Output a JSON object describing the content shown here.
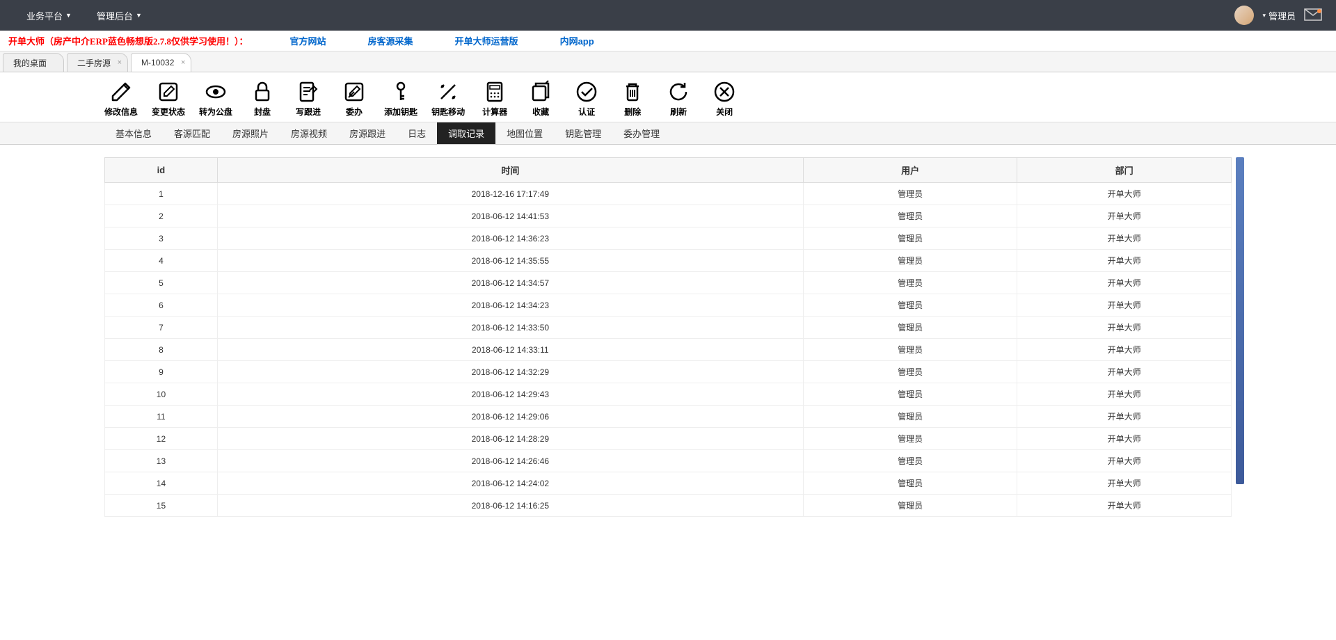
{
  "navbar": {
    "menus": [
      "业务平台",
      "管理后台"
    ],
    "user_label": "管理员"
  },
  "announce": {
    "title": "开单大师（房产中介ERP蓝色畅想版2.7.8仅供学习使用！）：",
    "links": [
      "官方网站",
      "房客源采集",
      "开单大师运营版",
      "内网app"
    ]
  },
  "doc_tabs": [
    {
      "label": "我的桌面",
      "closable": false
    },
    {
      "label": "二手房源",
      "closable": true
    },
    {
      "label": "M-10032",
      "closable": true,
      "active": true
    }
  ],
  "toolbar": [
    {
      "id": "edit-info",
      "label": "修改信息"
    },
    {
      "id": "change-status",
      "label": "变更状态"
    },
    {
      "id": "to-public",
      "label": "转为公盘"
    },
    {
      "id": "seal",
      "label": "封盘"
    },
    {
      "id": "write-followup",
      "label": "写跟进"
    },
    {
      "id": "delegate",
      "label": "委办"
    },
    {
      "id": "add-key",
      "label": "添加钥匙"
    },
    {
      "id": "key-move",
      "label": "钥匙移动"
    },
    {
      "id": "calculator",
      "label": "计算器"
    },
    {
      "id": "favorite",
      "label": "收藏"
    },
    {
      "id": "verify",
      "label": "认证"
    },
    {
      "id": "delete",
      "label": "删除"
    },
    {
      "id": "refresh",
      "label": "刷新"
    },
    {
      "id": "close",
      "label": "关闭"
    }
  ],
  "subtabs": [
    "基本信息",
    "客源匹配",
    "房源照片",
    "房源视频",
    "房源跟进",
    "日志",
    "调取记录",
    "地图位置",
    "钥匙管理",
    "委办管理"
  ],
  "subtab_active_index": 6,
  "table": {
    "headers": [
      "id",
      "时间",
      "用户",
      "部门"
    ],
    "rows": [
      {
        "id": "1",
        "time": "2018-12-16 17:17:49",
        "user": "管理员",
        "dept": "开单大师"
      },
      {
        "id": "2",
        "time": "2018-06-12 14:41:53",
        "user": "管理员",
        "dept": "开单大师"
      },
      {
        "id": "3",
        "time": "2018-06-12 14:36:23",
        "user": "管理员",
        "dept": "开单大师"
      },
      {
        "id": "4",
        "time": "2018-06-12 14:35:55",
        "user": "管理员",
        "dept": "开单大师"
      },
      {
        "id": "5",
        "time": "2018-06-12 14:34:57",
        "user": "管理员",
        "dept": "开单大师"
      },
      {
        "id": "6",
        "time": "2018-06-12 14:34:23",
        "user": "管理员",
        "dept": "开单大师"
      },
      {
        "id": "7",
        "time": "2018-06-12 14:33:50",
        "user": "管理员",
        "dept": "开单大师"
      },
      {
        "id": "8",
        "time": "2018-06-12 14:33:11",
        "user": "管理员",
        "dept": "开单大师"
      },
      {
        "id": "9",
        "time": "2018-06-12 14:32:29",
        "user": "管理员",
        "dept": "开单大师"
      },
      {
        "id": "10",
        "time": "2018-06-12 14:29:43",
        "user": "管理员",
        "dept": "开单大师"
      },
      {
        "id": "11",
        "time": "2018-06-12 14:29:06",
        "user": "管理员",
        "dept": "开单大师"
      },
      {
        "id": "12",
        "time": "2018-06-12 14:28:29",
        "user": "管理员",
        "dept": "开单大师"
      },
      {
        "id": "13",
        "time": "2018-06-12 14:26:46",
        "user": "管理员",
        "dept": "开单大师"
      },
      {
        "id": "14",
        "time": "2018-06-12 14:24:02",
        "user": "管理员",
        "dept": "开单大师"
      },
      {
        "id": "15",
        "time": "2018-06-12 14:16:25",
        "user": "管理员",
        "dept": "开单大师"
      }
    ]
  }
}
